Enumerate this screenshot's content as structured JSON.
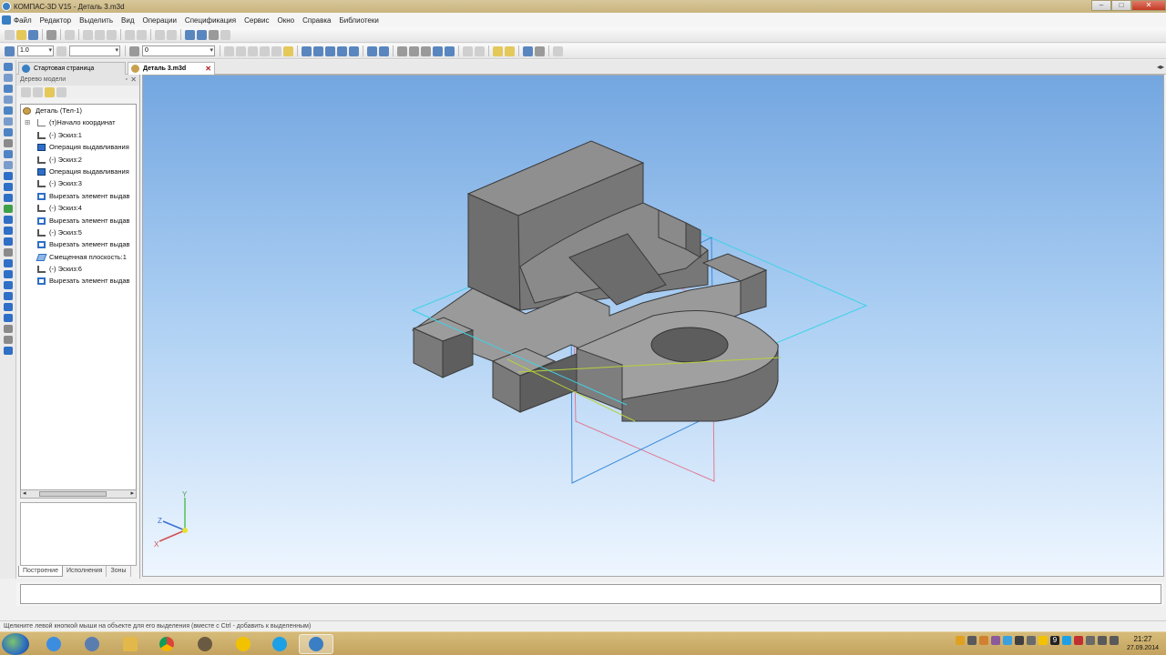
{
  "window": {
    "title": "КОМПАС-3D V15 - Деталь 3.m3d",
    "controls": [
      "–",
      "□",
      "✕"
    ]
  },
  "menu": [
    "Файл",
    "Редактор",
    "Выделить",
    "Вид",
    "Операции",
    "Спецификация",
    "Сервис",
    "Окно",
    "Справка",
    "Библиотеки"
  ],
  "toolbar": {
    "scale_value": "1.0",
    "layer_value": "0"
  },
  "tabs": [
    {
      "label": "Стартовая страница",
      "active": false
    },
    {
      "label": "Деталь 3.m3d",
      "active": true
    }
  ],
  "model_tree": {
    "title": "Дерево модели",
    "items": [
      {
        "label": "Деталь (Тел-1)",
        "icon": "part-icon",
        "level": 0
      },
      {
        "label": "(т)Начало координат",
        "icon": "origin-icon",
        "level": 1
      },
      {
        "label": "(-) Эскиз:1",
        "icon": "sketch-icon",
        "level": 2
      },
      {
        "label": "Операция выдавливания",
        "icon": "extrude-icon",
        "level": 2
      },
      {
        "label": "(-) Эскиз:2",
        "icon": "sketch-icon",
        "level": 2
      },
      {
        "label": "Операция выдавливания",
        "icon": "extrude-icon",
        "level": 2
      },
      {
        "label": "(-) Эскиз:3",
        "icon": "sketch-icon",
        "level": 2
      },
      {
        "label": "Вырезать элемент выдав",
        "icon": "cut-extrude-icon",
        "level": 2
      },
      {
        "label": "(-) Эскиз:4",
        "icon": "sketch-icon",
        "level": 2
      },
      {
        "label": "Вырезать элемент выдав",
        "icon": "cut-extrude-icon",
        "level": 2
      },
      {
        "label": "(-) Эскиз:5",
        "icon": "sketch-icon",
        "level": 2
      },
      {
        "label": "Вырезать элемент выдав",
        "icon": "cut-extrude-icon",
        "level": 2
      },
      {
        "label": "Смещенная плоскость:1",
        "icon": "plane-icon",
        "level": 2
      },
      {
        "label": "(-) Эскиз:6",
        "icon": "sketch-icon",
        "level": 2
      },
      {
        "label": "Вырезать элемент выдав",
        "icon": "cut-extrude-icon",
        "level": 2
      }
    ],
    "bottom_tabs": [
      "Построение",
      "Исполнения",
      "Зоны"
    ]
  },
  "axes_labels": {
    "x": "X",
    "y": "Y",
    "z": "Z"
  },
  "status": "Щелкните левой кнопкой мыши на объекте для его выделения (вместе с Ctrl - добавить к выделенным)",
  "taskbar": {
    "apps": [
      "internet-explorer-icon",
      "kompas-icon",
      "file-explorer-icon",
      "chrome-icon",
      "world-of-tanks-icon",
      "norton-icon",
      "skype-icon",
      "kompas-3d-icon"
    ],
    "tray_number": "9",
    "time": "21:27",
    "date": "27.09.2014"
  },
  "colors": {
    "accent": "#3a7fc4",
    "viewport_top": "#73a6e0",
    "viewport_bottom": "#eef6ff",
    "model": "#9a9a9a"
  }
}
